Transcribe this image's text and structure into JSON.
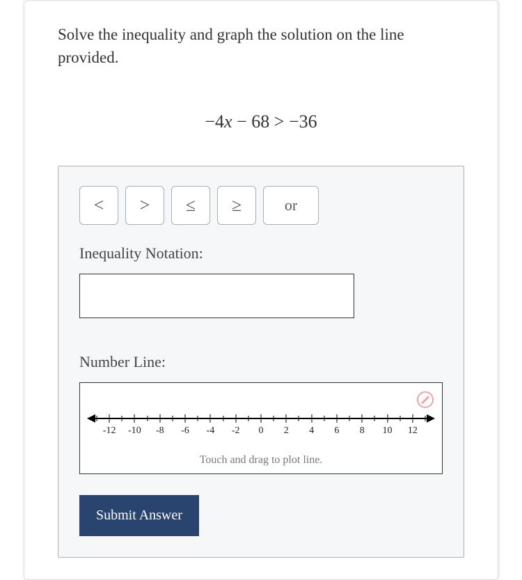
{
  "prompt": "Solve the inequality and graph the solution on the line provided.",
  "equation": {
    "lhs_coeff": "−4",
    "lhs_var": "x",
    "lhs_const": " − 68",
    "rel": " > ",
    "rhs": "−36"
  },
  "operators": {
    "lt": "<",
    "gt": ">",
    "le": "≤",
    "ge": "≥",
    "or": "or"
  },
  "labels": {
    "inequality": "Inequality Notation:",
    "numberline": "Number Line:",
    "hint": "Touch and drag to plot line.",
    "submit": "Submit Answer"
  },
  "input": {
    "value": ""
  },
  "chart_data": {
    "type": "numberline",
    "min": -13,
    "max": 13,
    "major_step": 2,
    "minor_step": 1,
    "major_ticks": [
      -12,
      -10,
      -8,
      -6,
      -4,
      -2,
      0,
      2,
      4,
      6,
      8,
      10,
      12
    ],
    "labels": [
      "-12",
      "-10",
      "-8",
      "-6",
      "-4",
      "-2",
      "0",
      "2",
      "4",
      "6",
      "8",
      "10",
      "12"
    ]
  }
}
